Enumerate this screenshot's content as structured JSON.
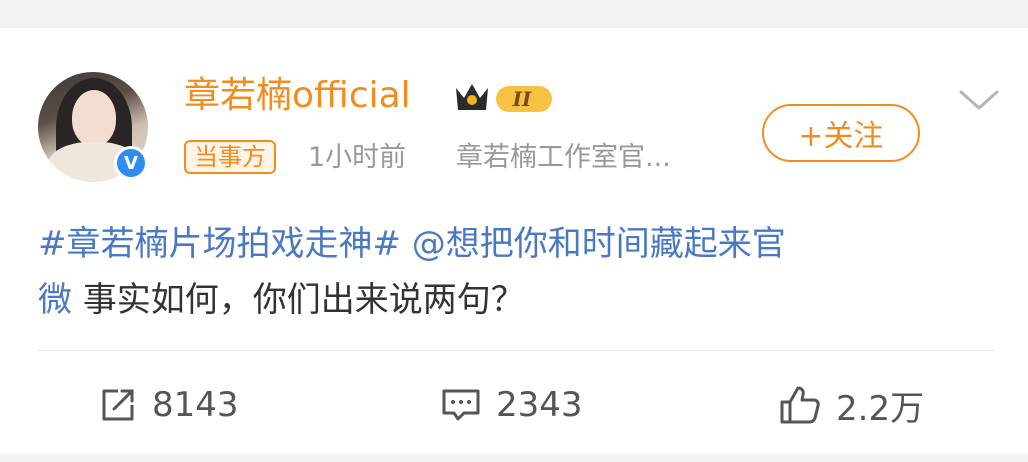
{
  "post": {
    "author_name": "章若楠official",
    "rank_badge": "II",
    "party_badge": "当事方",
    "time_ago": "1小时前",
    "source": "章若楠工作室官...",
    "follow_label": "+关注",
    "content": {
      "hashtag": "#章若楠片场拍戏走神#",
      "mention_part1": "@想把你和时间藏起来官",
      "mention_part2": "微",
      "text": "事实如何，你们出来说两句？"
    }
  },
  "actions": {
    "share_count": "8143",
    "comment_count": "2343",
    "like_count": "2.2万"
  },
  "colors": {
    "accent": "#f28c1f",
    "link": "#4a79c4",
    "verified": "#2f8cf0",
    "meta": "#999999"
  },
  "icons": [
    "share-icon",
    "comment-icon",
    "like-icon",
    "crown-icon",
    "verified-icon",
    "chevron-down-icon"
  ]
}
